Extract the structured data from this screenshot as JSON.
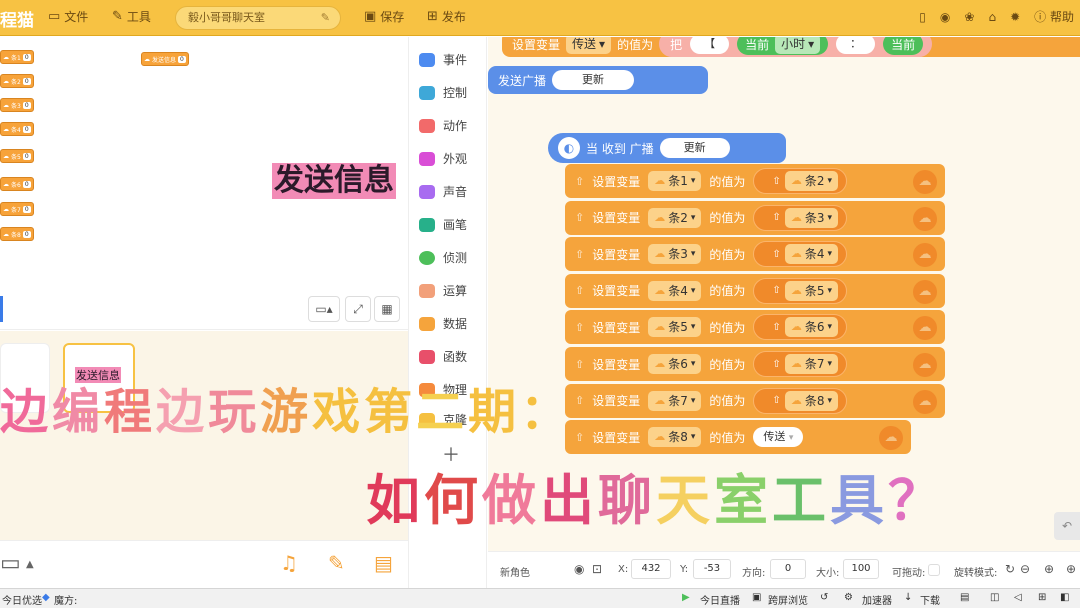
{
  "app": {
    "brand": "程猫",
    "menu_file": "文件",
    "menu_tools": "工具",
    "project_title": "毅小哥哥聊天室",
    "save": "保存",
    "publish": "发布",
    "help": "帮助"
  },
  "stage": {
    "text_sprite": "发送信息",
    "variables": [
      {
        "label": "条1",
        "value": "0"
      },
      {
        "label": "条2",
        "value": "0"
      },
      {
        "label": "条3",
        "value": "0"
      },
      {
        "label": "条4",
        "value": "0"
      },
      {
        "label": "条5",
        "value": "0"
      },
      {
        "label": "条6",
        "value": "0"
      },
      {
        "label": "条7",
        "value": "0"
      },
      {
        "label": "条8",
        "value": "0"
      }
    ],
    "send_var": {
      "label": "发送信息",
      "value": "0"
    }
  },
  "sprites": {
    "selected_thumb": "发送信息"
  },
  "categories": [
    {
      "label": "事件",
      "color": "#4d8bf0"
    },
    {
      "label": "控制",
      "color": "#3ea8d8"
    },
    {
      "label": "动作",
      "color": "#f26a6a"
    },
    {
      "label": "外观",
      "color": "#d94ed6"
    },
    {
      "label": "声音",
      "color": "#a86bf0"
    },
    {
      "label": "画笔",
      "color": "#27b08a"
    },
    {
      "label": "侦测",
      "color": "#4dbf5a"
    },
    {
      "label": "运算",
      "color": "#f2a07a"
    },
    {
      "label": "数据",
      "color": "#f5a43c"
    },
    {
      "label": "函数",
      "color": "#e84f6a"
    },
    {
      "label": "物理",
      "color": "#f58a3c"
    },
    {
      "label": "克隆",
      "color": "#f5c040"
    }
  ],
  "code": {
    "top_block": {
      "set_label": "设置变量",
      "var": "传送",
      "value_label": "的值为",
      "join_label": "把",
      "bracket": "【",
      "current_label": "当前",
      "current_val": "小时",
      "colon": "：",
      "current_label2": "当前"
    },
    "broadcast_block": {
      "label": "发送广播",
      "message": "更新"
    },
    "hat_block": {
      "label": "当 收到 广播",
      "message": "更新"
    },
    "set_rows": [
      {
        "var": "条1",
        "value_var": "条2"
      },
      {
        "var": "条2",
        "value_var": "条3"
      },
      {
        "var": "条3",
        "value_var": "条4"
      },
      {
        "var": "条4",
        "value_var": "条5"
      },
      {
        "var": "条5",
        "value_var": "条6"
      },
      {
        "var": "条6",
        "value_var": "条7"
      },
      {
        "var": "条7",
        "value_var": "条8"
      }
    ],
    "last_row": {
      "var": "条8",
      "value_var": "传送"
    },
    "set_label": "设置变量",
    "value_label": "的值为"
  },
  "props": {
    "role": "新角色",
    "x_label": "X:",
    "x": "432",
    "y_label": "Y:",
    "y": "-53",
    "dir_label": "方向:",
    "dir": "0",
    "size_label": "大小:",
    "size": "100",
    "drag_label": "可拖动:",
    "rotate_label": "旋转模式:"
  },
  "taskbar": {
    "t1": "今日优选",
    "t2": "魔方:",
    "t3": "今日直播",
    "t4": "跨屏浏览",
    "t5": "加速器",
    "t6": "下载"
  },
  "overlay": {
    "line1": [
      "边",
      "编",
      "程",
      "边",
      "玩",
      "游",
      "戏",
      "第",
      "二",
      "期",
      "："
    ],
    "line1_colors": [
      "#f06a9a",
      "#f08aa6",
      "#f07a7a",
      "#f5a0b0",
      "#f08a9a",
      "#f0a050",
      "#f5c040",
      "#f5c040",
      "#f5d050",
      "#f5c040",
      "#f5c040"
    ],
    "line2": [
      "如",
      "何",
      "做",
      "出",
      "聊",
      "天",
      "室",
      "工",
      "具",
      "？"
    ],
    "line2_colors": [
      "#e03a5a",
      "#e04a4a",
      "#f07a9a",
      "#e04a7a",
      "#e06a9a",
      "#f5d060",
      "#8ad06a",
      "#6ac06a",
      "#8a9ae0",
      "#e070c0"
    ]
  }
}
